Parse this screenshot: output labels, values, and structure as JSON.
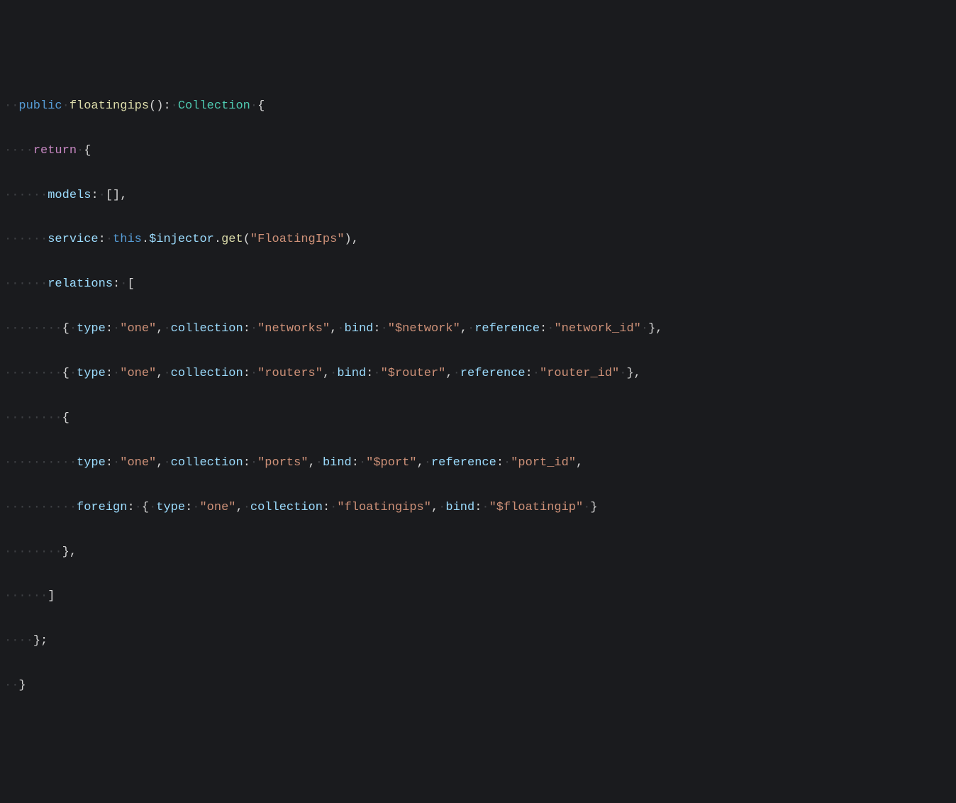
{
  "line1": {
    "ws": "··",
    "public": "public",
    "sp1": "·",
    "fn": "floatingips",
    "lparen": "(",
    "rparen": ")",
    "colon": ":",
    "sp2": "·",
    "type": "Collection",
    "sp3": "·",
    "lbrace": "{"
  },
  "line2": {
    "ws": "····",
    "return": "return",
    "sp": "·",
    "lbrace": "{"
  },
  "line3": {
    "ws": "······",
    "prop": "models",
    "colon": ":",
    "sp": "·",
    "lbracket": "[",
    "rbracket": "]",
    "comma": ","
  },
  "line4": {
    "ws": "······",
    "prop": "service",
    "colon": ":",
    "sp1": "·",
    "this": "this",
    "dot1": ".",
    "injector": "$injector",
    "dot2": ".",
    "get": "get",
    "lparen": "(",
    "str": "\"FloatingIps\"",
    "rparen": ")",
    "comma": ","
  },
  "line5": {
    "ws": "······",
    "prop": "relations",
    "colon": ":",
    "sp": "·",
    "lbracket": "["
  },
  "line6": {
    "ws": "········",
    "lbrace": "{",
    "sp1": "·",
    "type_k": "type",
    "c1": ":",
    "sp2": "·",
    "type_v": "\"one\"",
    "comma1": ",",
    "sp3": "·",
    "coll_k": "collection",
    "c2": ":",
    "sp4": "·",
    "coll_v": "\"networks\"",
    "comma2": ",",
    "sp5": "·",
    "bind_k": "bind",
    "c3": ":",
    "sp6": "·",
    "bind_v": "\"$network\"",
    "comma3": ",",
    "sp7": "·",
    "ref_k": "reference",
    "c4": ":",
    "sp8": "·",
    "ref_v": "\"network_id\"",
    "sp9": "·",
    "rbrace": "}",
    "comma4": ","
  },
  "line7": {
    "ws": "········",
    "lbrace": "{",
    "sp1": "·",
    "type_k": "type",
    "c1": ":",
    "sp2": "·",
    "type_v": "\"one\"",
    "comma1": ",",
    "sp3": "·",
    "coll_k": "collection",
    "c2": ":",
    "sp4": "·",
    "coll_v": "\"routers\"",
    "comma2": ",",
    "sp5": "·",
    "bind_k": "bind",
    "c3": ":",
    "sp6": "·",
    "bind_v": "\"$router\"",
    "comma3": ",",
    "sp7": "·",
    "ref_k": "reference",
    "c4": ":",
    "sp8": "·",
    "ref_v": "\"router_id\"",
    "sp9": "·",
    "rbrace": "}",
    "comma4": ","
  },
  "line8": {
    "ws": "········",
    "lbrace": "{"
  },
  "line9": {
    "ws": "··········",
    "type_k": "type",
    "c1": ":",
    "sp1": "·",
    "type_v": "\"one\"",
    "comma1": ",",
    "sp2": "·",
    "coll_k": "collection",
    "c2": ":",
    "sp3": "·",
    "coll_v": "\"ports\"",
    "comma2": ",",
    "sp4": "·",
    "bind_k": "bind",
    "c3": ":",
    "sp5": "·",
    "bind_v": "\"$port\"",
    "comma3": ",",
    "sp6": "·",
    "ref_k": "reference",
    "c4": ":",
    "sp7": "·",
    "ref_v": "\"port_id\"",
    "comma4": ","
  },
  "line10": {
    "ws": "··········",
    "foreign_k": "foreign",
    "c1": ":",
    "sp1": "·",
    "lbrace": "{",
    "sp2": "·",
    "type_k": "type",
    "c2": ":",
    "sp3": "·",
    "type_v": "\"one\"",
    "comma1": ",",
    "sp4": "·",
    "coll_k": "collection",
    "c3": ":",
    "sp5": "·",
    "coll_v": "\"floatingips\"",
    "comma2": ",",
    "sp6": "·",
    "bind_k": "bind",
    "c4": ":",
    "sp7": "·",
    "bind_v": "\"$floatingip\"",
    "sp8": "·",
    "rbrace": "}"
  },
  "line11": {
    "ws": "········",
    "rbrace": "}",
    "comma": ","
  },
  "line12": {
    "ws": "······",
    "rbracket": "]"
  },
  "line13": {
    "ws": "····",
    "rbrace": "}",
    "semi": ";"
  },
  "line14": {
    "ws": "··",
    "rbrace": "}"
  }
}
